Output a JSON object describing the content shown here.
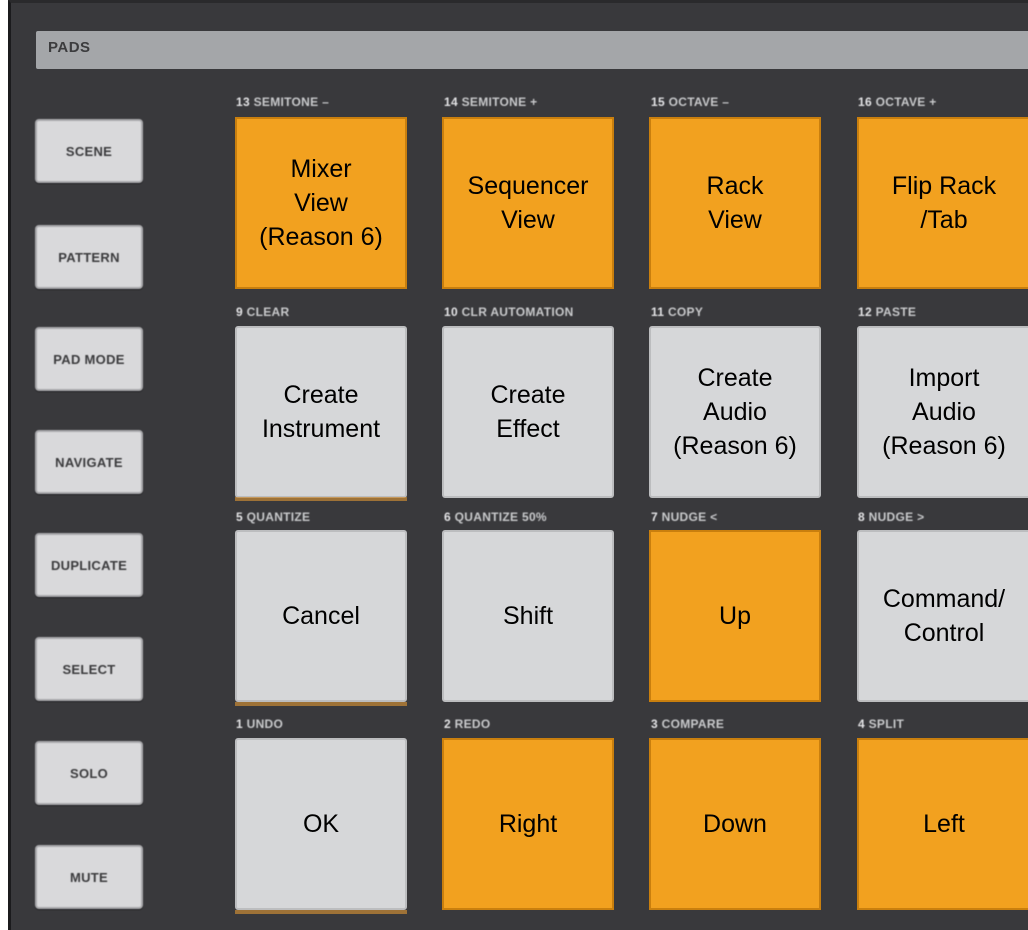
{
  "header": {
    "title": "PADS"
  },
  "side_buttons": [
    {
      "label": "SCENE"
    },
    {
      "label": "PATTERN"
    },
    {
      "label": "PAD MODE"
    },
    {
      "label": "NAVIGATE"
    },
    {
      "label": "DUPLICATE"
    },
    {
      "label": "SELECT"
    },
    {
      "label": "SOLO"
    },
    {
      "label": "MUTE"
    }
  ],
  "pads": [
    {
      "num": "13",
      "hw": "SEMITONE –",
      "text": "Mixer\nView\n(Reason 6)",
      "color": "#f2a11f"
    },
    {
      "num": "14",
      "hw": "SEMITONE +",
      "text": "Sequencer\nView",
      "color": "#f2a11f"
    },
    {
      "num": "15",
      "hw": "OCTAVE –",
      "text": "Rack\nView",
      "color": "#f2a11f"
    },
    {
      "num": "16",
      "hw": "OCTAVE +",
      "text": "Flip Rack\n/Tab",
      "color": "#f2a11f"
    },
    {
      "num": "9",
      "hw": "CLEAR",
      "text": "Create\nInstrument",
      "color": "#d6d7d9"
    },
    {
      "num": "10",
      "hw": "CLR AUTOMATION",
      "text": "Create\nEffect",
      "color": "#d6d7d9"
    },
    {
      "num": "11",
      "hw": "COPY",
      "text": "Create\nAudio\n(Reason 6)",
      "color": "#d6d7d9"
    },
    {
      "num": "12",
      "hw": "PASTE",
      "text": "Import\nAudio\n(Reason 6)",
      "color": "#d6d7d9"
    },
    {
      "num": "5",
      "hw": "QUANTIZE",
      "text": "Cancel",
      "color": "#d6d7d9"
    },
    {
      "num": "6",
      "hw": "QUANTIZE 50%",
      "text": "Shift",
      "color": "#d6d7d9"
    },
    {
      "num": "7",
      "hw": "NUDGE <",
      "text": "Up",
      "color": "#f2a11f"
    },
    {
      "num": "8",
      "hw": "NUDGE >",
      "text": "Command/\nControl",
      "color": "#d6d7d9"
    },
    {
      "num": "1",
      "hw": "UNDO",
      "text": "OK",
      "color": "#d6d7d9"
    },
    {
      "num": "2",
      "hw": "REDO",
      "text": "Right",
      "color": "#f2a11f"
    },
    {
      "num": "3",
      "hw": "COMPARE",
      "text": "Down",
      "color": "#f2a11f"
    },
    {
      "num": "4",
      "hw": "SPLIT",
      "text": "Left",
      "color": "#f2a11f"
    }
  ]
}
